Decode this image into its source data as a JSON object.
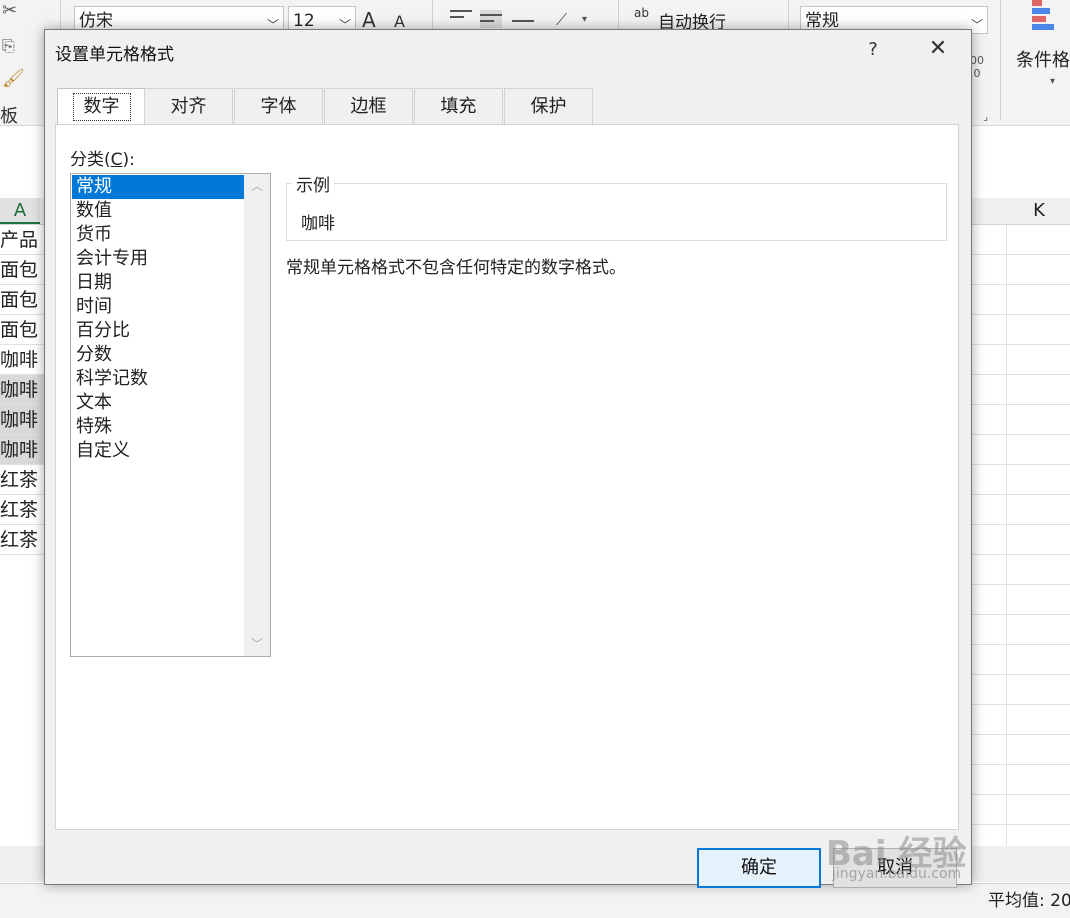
{
  "ribbon": {
    "font_name": "仿宋",
    "font_size": "12",
    "grow_font": "A",
    "shrink_font": "A",
    "wrap_icon_text": "ab",
    "wrap_text": "自动换行",
    "number_format": "常规",
    "conditional_format": "条件格",
    "clipboard_label": "板",
    "decimal_hint": "00\n.0"
  },
  "sheet": {
    "column_a": "A",
    "column_k": "K",
    "cells": [
      "产品",
      "面包",
      "面包",
      "面包",
      "咖啡",
      "咖啡",
      "咖啡",
      "咖啡",
      "红茶",
      "红茶",
      "红茶"
    ],
    "status_average": "平均值: 20"
  },
  "dialog": {
    "title": "设置单元格格式",
    "help": "?",
    "close": "✕",
    "tabs": [
      "数字",
      "对齐",
      "字体",
      "边框",
      "填充",
      "保护"
    ],
    "category_label": "分类(",
    "category_hotkey": "C",
    "category_label_end": "):",
    "categories": [
      "常规",
      "数值",
      "货币",
      "会计专用",
      "日期",
      "时间",
      "百分比",
      "分数",
      "科学记数",
      "文本",
      "特殊",
      "自定义"
    ],
    "selected_category": "常规",
    "sample_legend": "示例",
    "sample_value": "咖啡",
    "description": "常规单元格格式不包含任何特定的数字格式。",
    "ok_label": "确定",
    "cancel_label": "取消"
  },
  "watermark": {
    "text": "Bai 经验",
    "sub": "jingyan.baidu.com"
  }
}
